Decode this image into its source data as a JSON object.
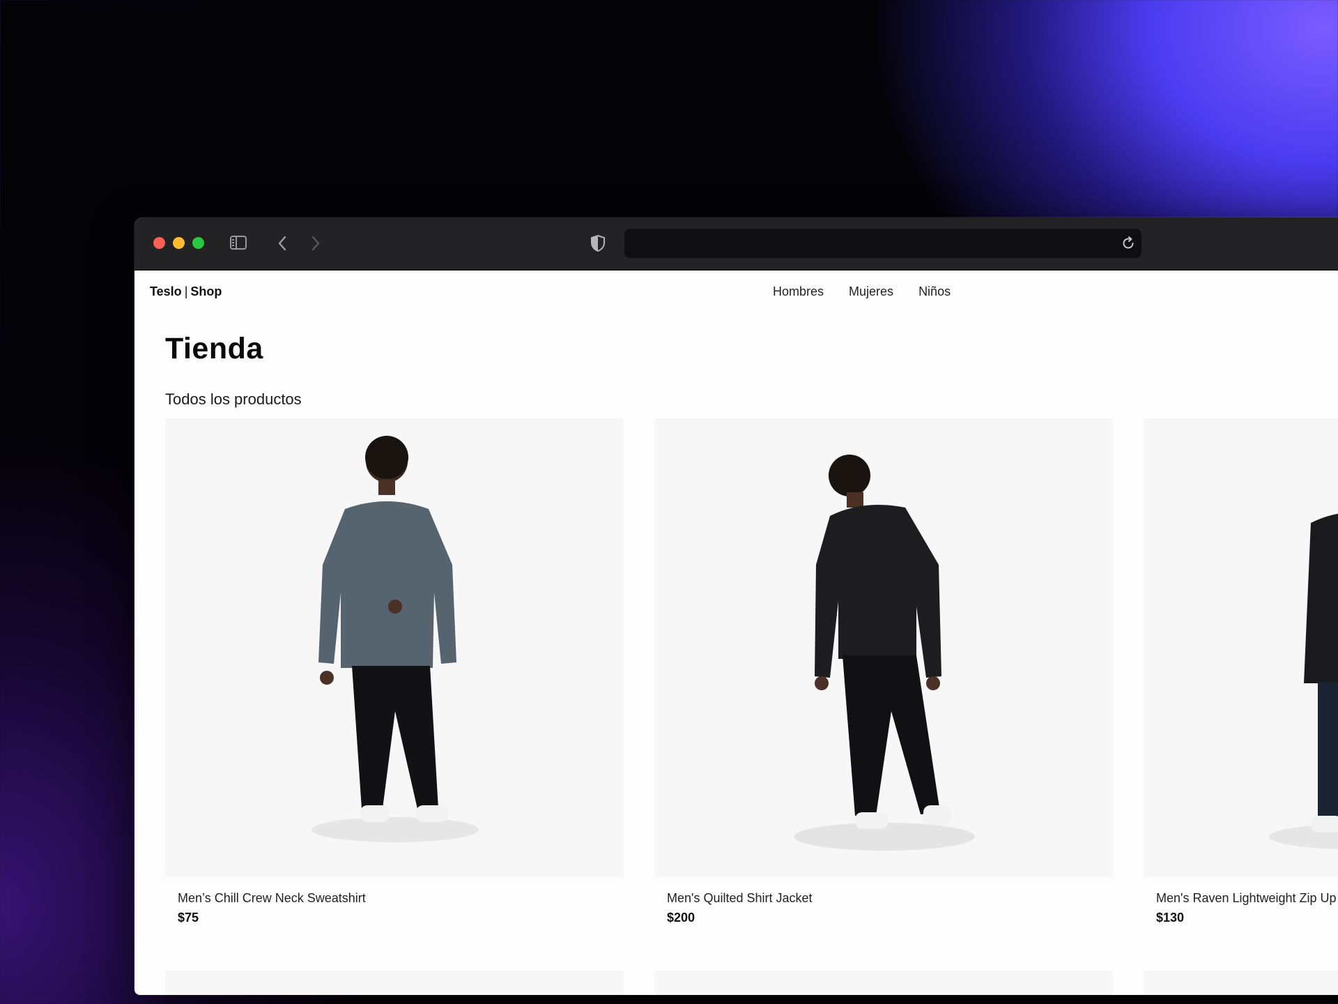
{
  "browser": {
    "address_value": ""
  },
  "header": {
    "brand_primary": "Teslo",
    "brand_separator": "|",
    "brand_secondary": "Shop",
    "nav": [
      {
        "label": "Hombres"
      },
      {
        "label": "Mujeres"
      },
      {
        "label": "Niños"
      }
    ]
  },
  "main": {
    "title": "Tienda",
    "subtitle": "Todos los productos",
    "products": [
      {
        "name": "Men’s Chill Crew Neck Sweatshirt",
        "price": "$75",
        "top_color": "#55646f",
        "bottom_color": "#121214"
      },
      {
        "name": "Men's Quilted Shirt Jacket",
        "price": "$200",
        "top_color": "#1d1d1f",
        "bottom_color": "#111113"
      },
      {
        "name": "Men's Raven Lightweight Zip Up Bomber Jacket",
        "price": "$130",
        "top_color": "#1a1a1c",
        "bottom_color": "#1c2433"
      }
    ]
  },
  "colors": {
    "traffic_red": "#fe5f57",
    "traffic_yellow": "#febc2e",
    "traffic_green": "#28c840",
    "titlebar": "#232325"
  }
}
